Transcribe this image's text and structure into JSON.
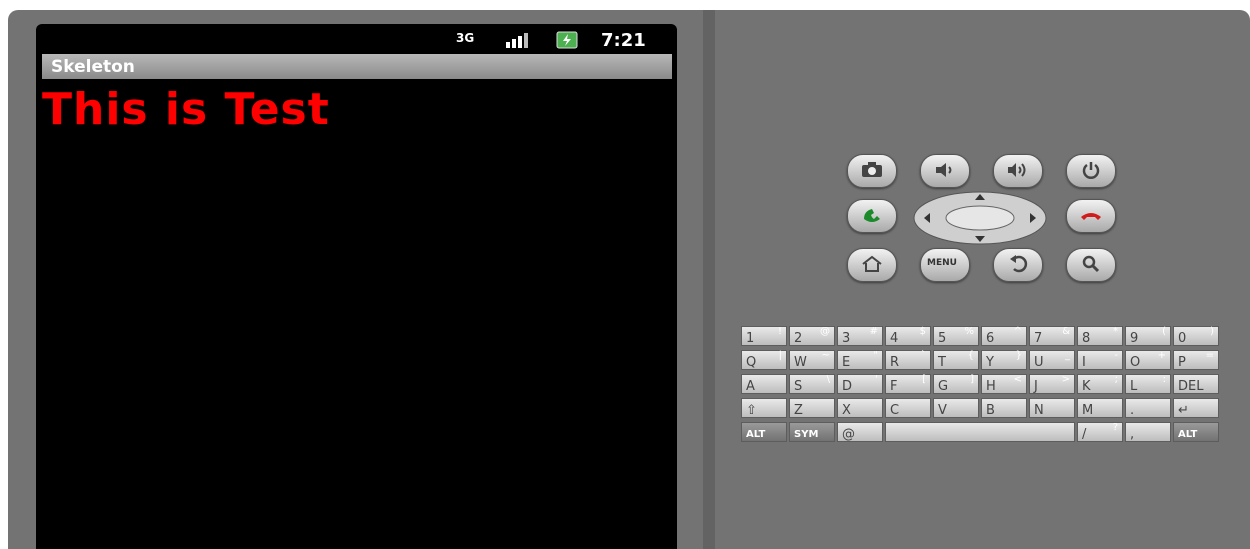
{
  "status_bar": {
    "network": "3G",
    "time": "7:21"
  },
  "app": {
    "title": "Skeleton",
    "text": "This is Test",
    "text_color": "#ff0000"
  },
  "controls": {
    "menu_label": "MENU"
  },
  "keyboard": {
    "rows": [
      [
        {
          "m": "1",
          "s": "!"
        },
        {
          "m": "2",
          "s": "@"
        },
        {
          "m": "3",
          "s": "#"
        },
        {
          "m": "4",
          "s": "$"
        },
        {
          "m": "5",
          "s": "%"
        },
        {
          "m": "6",
          "s": "^"
        },
        {
          "m": "7",
          "s": "&"
        },
        {
          "m": "8",
          "s": "*"
        },
        {
          "m": "9",
          "s": "("
        },
        {
          "m": "0",
          "s": ")"
        }
      ],
      [
        {
          "m": "Q",
          "s": "|"
        },
        {
          "m": "W",
          "s": "~"
        },
        {
          "m": "E",
          "s": "\""
        },
        {
          "m": "R",
          "s": "`"
        },
        {
          "m": "T",
          "s": "{"
        },
        {
          "m": "Y",
          "s": "}"
        },
        {
          "m": "U",
          "s": "_"
        },
        {
          "m": "I",
          "s": "-"
        },
        {
          "m": "O",
          "s": "+"
        },
        {
          "m": "P",
          "s": "="
        }
      ],
      [
        {
          "m": "A",
          "s": ""
        },
        {
          "m": "S",
          "s": "\\"
        },
        {
          "m": "D",
          "s": "'"
        },
        {
          "m": "F",
          "s": "["
        },
        {
          "m": "G",
          "s": "]"
        },
        {
          "m": "H",
          "s": "<"
        },
        {
          "m": "J",
          "s": ">"
        },
        {
          "m": "K",
          "s": ";"
        },
        {
          "m": "L",
          "s": ":"
        },
        {
          "m": "DEL",
          "s": ""
        }
      ],
      [
        {
          "m": "⇧",
          "s": ""
        },
        {
          "m": "Z",
          "s": ""
        },
        {
          "m": "X",
          "s": ""
        },
        {
          "m": "C",
          "s": ""
        },
        {
          "m": "V",
          "s": ""
        },
        {
          "m": "B",
          "s": ""
        },
        {
          "m": "N",
          "s": ""
        },
        {
          "m": "M",
          "s": ""
        },
        {
          "m": ".",
          "s": ""
        },
        {
          "m": "↵",
          "s": ""
        }
      ],
      [
        {
          "m": "ALT",
          "s": ""
        },
        {
          "m": "SYM",
          "s": ""
        },
        {
          "m": "@",
          "s": ""
        },
        {
          "m": "",
          "s": ""
        },
        {
          "m": "",
          "s": ""
        },
        {
          "m": "",
          "s": ""
        },
        {
          "m": "",
          "s": ""
        },
        {
          "m": "/",
          "s": "?"
        },
        {
          "m": ",",
          "s": ""
        },
        {
          "m": "ALT",
          "s": ""
        }
      ]
    ]
  }
}
